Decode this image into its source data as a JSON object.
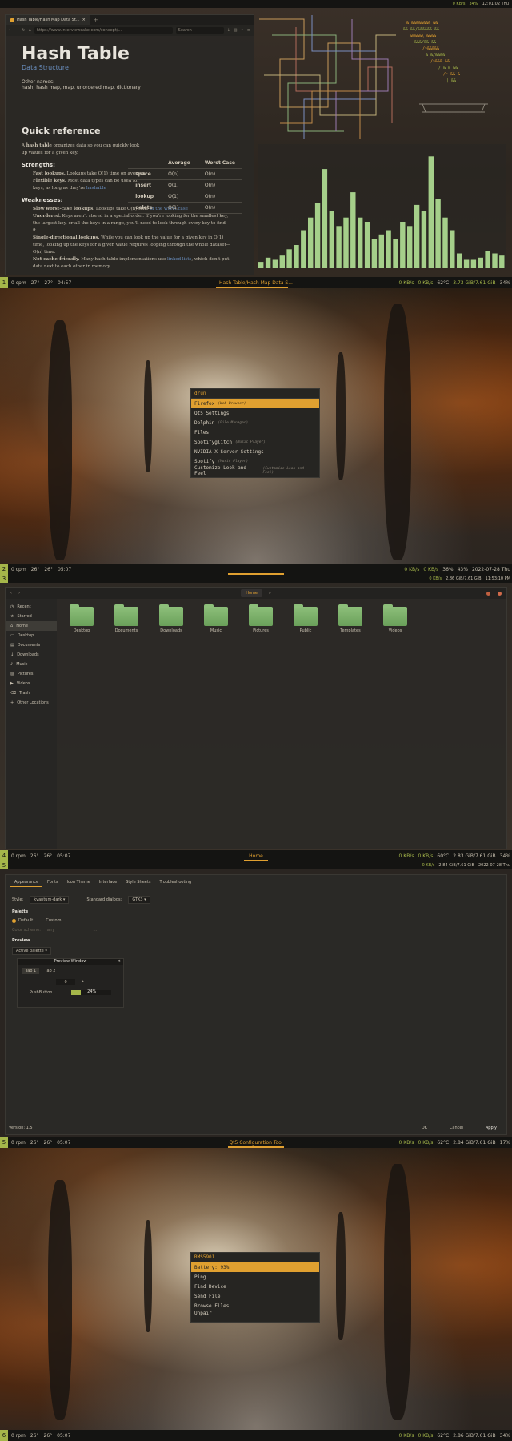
{
  "colors": {
    "accent": "#e0a030",
    "green": "#a5b64a",
    "bg": "#1c1b19",
    "link": "#6a8fc0",
    "chart": "#a5cf8a"
  },
  "panels": [
    {
      "ws": "1",
      "left": [
        "0 cpm",
        "27°",
        "27°",
        "04:57"
      ],
      "title": "Hash Table/Hash Map Data S...",
      "right": [
        "0 KB/s",
        "0 KB/s",
        "62°C",
        "3.73 GiB/7.61 GiB",
        "34%"
      ],
      "time_top": "12:01:02 Thu"
    },
    {
      "ws": "2",
      "left": [
        "0 cpm",
        "26°",
        "26°",
        "05:07"
      ],
      "title": "",
      "right": [
        "0 KB/s",
        "0 KB/s",
        "36%",
        "43%",
        "2022-07-28 Thu"
      ],
      "time_top": "2022-07-28 Thu"
    },
    {
      "ws": "3",
      "left": [
        "0 rpm",
        "26°",
        "26°",
        "05:07"
      ],
      "title": "",
      "right": [
        "0 KB/s",
        "0 KB/s",
        "60°C",
        "2.86 GiB/7.61 GiB",
        "34%"
      ],
      "time_top": "11:53:10 PM"
    },
    {
      "ws": "4",
      "left": [
        "0 rpm",
        "26°",
        "26°",
        "05:07"
      ],
      "title": "Home",
      "right": [
        "0 KB/s",
        "0 KB/s",
        "60°C",
        "2.83 GiB/7.61 GiB",
        "34%"
      ],
      "time_top": "2022-07-28 Thu"
    },
    {
      "ws": "5",
      "left": [
        "0 rpm",
        "26°",
        "26°",
        "05:07"
      ],
      "title": "Qt5 Configuration Tool",
      "right": [
        "0 KB/s",
        "0 KB/s",
        "62°C",
        "2.84 GiB/7.61 GiB",
        "17%"
      ],
      "time_top": "11:52:14 PM"
    },
    {
      "ws": "6",
      "left": [
        "0 rpm",
        "26°",
        "26°",
        "05:07"
      ],
      "title": "",
      "right": [
        "0 KB/s",
        "0 KB/s",
        "62°C",
        "2.86 GiB/7.61 GiB",
        "34%"
      ],
      "time_top": ""
    }
  ],
  "browser": {
    "tab_title": "Hash Table/Hash Map Data St...",
    "url": "https://www.interviewcake.com/concept/...",
    "search_placeholder": "Search",
    "title": "Hash Table",
    "subtitle": "Data Structure",
    "other_names_label": "Other names:",
    "other_names": "hash, hash map, map, unordered map, dictionary",
    "quick_ref": "Quick reference",
    "intro_pre": "A ",
    "intro_bold": "hash table",
    "intro_post": " organizes data so you can quickly look up values for a given key.",
    "strengths": "Strengths:",
    "s1_b": "Fast lookups.",
    "s1": " Lookups take O(1) time on average.",
    "s2_b": "Flexible keys.",
    "s2": " Most data types can be used for keys, as long as they're ",
    "s2_link": "hashable",
    "weaknesses": "Weaknesses:",
    "w1_b": "Slow worst-case lookups.",
    "w1": " Lookups take O(n) time ",
    "w1_link": "in the worst case",
    "w2_b": "Unordered.",
    "w2": " Keys aren't stored in a special order. If you're looking for the smallest key, the largest key, or all the keys in a range, you'll need to look through every key to find it.",
    "w3_b": "Single-directional lookups.",
    "w3": " While you can look up the value for a given key in O(1) time, looking up the keys for a given value requires looping through the whole dataset—O(n) time.",
    "w4_b": "Not cache-friendly.",
    "w4": " Many hash table implementations use ",
    "w4_link": "linked lists",
    "w4_post": ", which don't put data next to each other in memory.",
    "table": {
      "headers": [
        "",
        "Average",
        "Worst Case"
      ],
      "rows": [
        [
          "space",
          "O(n)",
          "O(n)"
        ],
        [
          "insert",
          "O(1)",
          "O(n)"
        ],
        [
          "lookup",
          "O(1)",
          "O(n)"
        ],
        [
          "delete",
          "O(1)",
          "O(n)"
        ]
      ]
    }
  },
  "visualizer": {
    "values": [
      3,
      5,
      4,
      6,
      9,
      11,
      18,
      24,
      31,
      47,
      27,
      20,
      24,
      36,
      24,
      22,
      14,
      16,
      18,
      14,
      22,
      20,
      30,
      27,
      53,
      33,
      24,
      18,
      7,
      4,
      4,
      5,
      8,
      7,
      6
    ]
  },
  "launcher": {
    "header": "drun",
    "items": [
      {
        "name": "Firefox",
        "desc": "(Web Browser)"
      },
      {
        "name": "Qt5 Settings",
        "desc": ""
      },
      {
        "name": "Dolphin",
        "desc": "(File Manager)"
      },
      {
        "name": "Files",
        "desc": ""
      },
      {
        "name": "Spotifyglitch",
        "desc": "(Music Player)"
      },
      {
        "name": "NVIDIA X Server Settings",
        "desc": ""
      },
      {
        "name": "Spotify",
        "desc": "(Music Player)"
      },
      {
        "name": "Customize Look and Feel",
        "desc": "(Customize Look and Feel)"
      }
    ]
  },
  "bt_menu": {
    "header": "RMS5901",
    "items": [
      "Battery: 93%",
      "Ping",
      "Find Device",
      "Send File",
      "Browse Files",
      "Unpair"
    ]
  },
  "files": {
    "location": "Home",
    "sidebar": [
      "Recent",
      "Starred",
      "Home",
      "Desktop",
      "Documents",
      "Downloads",
      "Music",
      "Pictures",
      "Videos",
      "Trash",
      "Other Locations"
    ],
    "folders": [
      "Desktop",
      "Documents",
      "Downloads",
      "Music",
      "Pictures",
      "Public",
      "Templates",
      "Videos"
    ]
  },
  "qt5ct": {
    "tabs": [
      "Appearance",
      "Fonts",
      "Icon Theme",
      "Interface",
      "Style Sheets",
      "Troubleshooting"
    ],
    "style_label": "Style:",
    "style_value": "kvantum-dark",
    "dialogs_label": "Standard dialogs:",
    "dialogs_value": "GTK3",
    "palette_label": "Palette",
    "default": "Default",
    "custom": "Custom",
    "color_scheme_label": "Color scheme:",
    "color_scheme_value": "airy",
    "preview_label": "Preview",
    "active_palette": "Active palette",
    "preview_window": "Preview Window",
    "tab1": "Tab 1",
    "tab2": "Tab 2",
    "spin_value": "0",
    "pushbutton": "PushButton",
    "progress": "24%",
    "version": "Version: 1.5",
    "ok": "OK",
    "cancel": "Cancel",
    "apply": "Apply"
  }
}
